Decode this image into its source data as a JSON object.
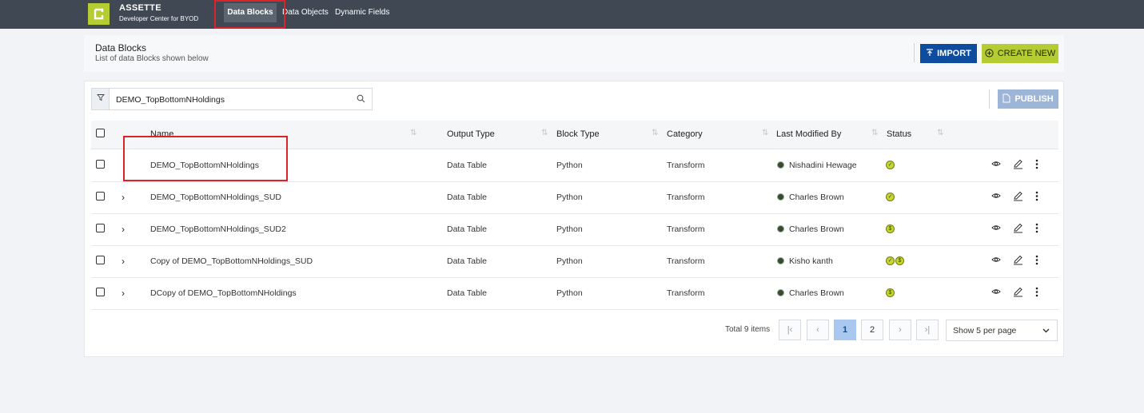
{
  "app": {
    "name": "ASSETTE",
    "subtitle": "Developer Center for BYOD"
  },
  "nav": {
    "items": [
      {
        "label": "Data Blocks",
        "active": true
      },
      {
        "label": "Data Objects",
        "active": false
      },
      {
        "label": "Dynamic Fields",
        "active": false
      }
    ]
  },
  "header": {
    "title": "Data Blocks",
    "subtitle": "List of data Blocks shown below",
    "import_label": "IMPORT",
    "create_label": "CREATE NEW"
  },
  "toolbar": {
    "search_value": "DEMO_TopBottomNHoldings",
    "publish_label": "PUBLISH"
  },
  "table": {
    "columns": [
      "Name",
      "Output Type",
      "Block Type",
      "Category",
      "Last Modified By",
      "Status"
    ],
    "rows": [
      {
        "name": "DEMO_TopBottomNHoldings",
        "output": "Data Table",
        "block": "Python",
        "category": "Transform",
        "modified_by": "Nishadini Hewage",
        "status": [
          "check"
        ],
        "expandable": false
      },
      {
        "name": "DEMO_TopBottomNHoldings_SUD",
        "output": "Data Table",
        "block": "Python",
        "category": "Transform",
        "modified_by": "Charles Brown",
        "status": [
          "check"
        ],
        "expandable": true
      },
      {
        "name": "DEMO_TopBottomNHoldings_SUD2",
        "output": "Data Table",
        "block": "Python",
        "category": "Transform",
        "modified_by": "Charles Brown",
        "status": [
          "draft"
        ],
        "expandable": true
      },
      {
        "name": "Copy of DEMO_TopBottomNHoldings_SUD",
        "output": "Data Table",
        "block": "Python",
        "category": "Transform",
        "modified_by": "Kisho kanth",
        "status": [
          "check",
          "draft"
        ],
        "expandable": true
      },
      {
        "name": "DCopy of DEMO_TopBottomNHoldings",
        "output": "Data Table",
        "block": "Python",
        "category": "Transform",
        "modified_by": "Charles Brown",
        "status": [
          "draft"
        ],
        "expandable": true
      }
    ]
  },
  "pagination": {
    "total_label": "Total 9 items",
    "pages": [
      "1",
      "2"
    ],
    "current_page": "1",
    "per_page": "Show 5 per page"
  },
  "colors": {
    "topbar": "#3f4853",
    "brand_accent": "#b5cd33",
    "primary_blue": "#0e4ca0",
    "highlight_red": "#d9242b"
  }
}
